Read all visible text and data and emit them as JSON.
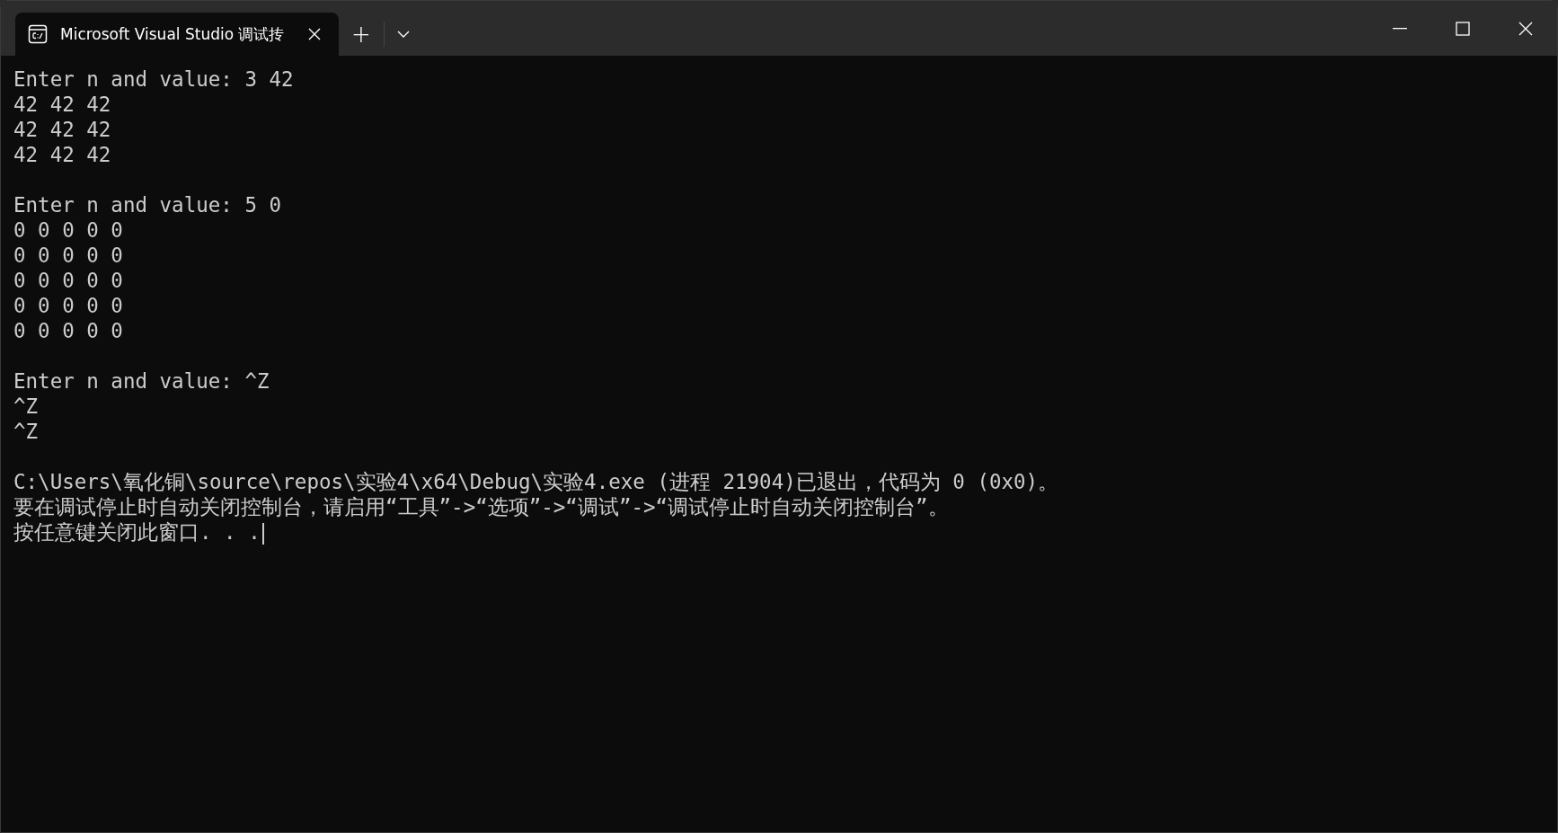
{
  "window": {
    "tab": {
      "title": "Microsoft Visual Studio 调试抟",
      "selected": true
    },
    "new_tab": "+"
  },
  "console": {
    "blocks": [
      [
        "Enter n and value: 3 42",
        "42 42 42",
        "42 42 42",
        "42 42 42"
      ],
      [
        "Enter n and value: 5 0",
        "0 0 0 0 0",
        "0 0 0 0 0",
        "0 0 0 0 0",
        "0 0 0 0 0",
        "0 0 0 0 0"
      ],
      [
        "Enter n and value: ^Z",
        "^Z",
        "^Z"
      ],
      [
        "C:\\Users\\氧化铜\\source\\repos\\实验4\\x64\\Debug\\实验4.exe (进程 21904)已退出，代码为 0 (0x0)。",
        "要在调试停止时自动关闭控制台，请启用“工具”->“选项”->“调试”->“调试停止时自动关闭控制台”。",
        "按任意键关闭此窗口. . ."
      ]
    ]
  }
}
